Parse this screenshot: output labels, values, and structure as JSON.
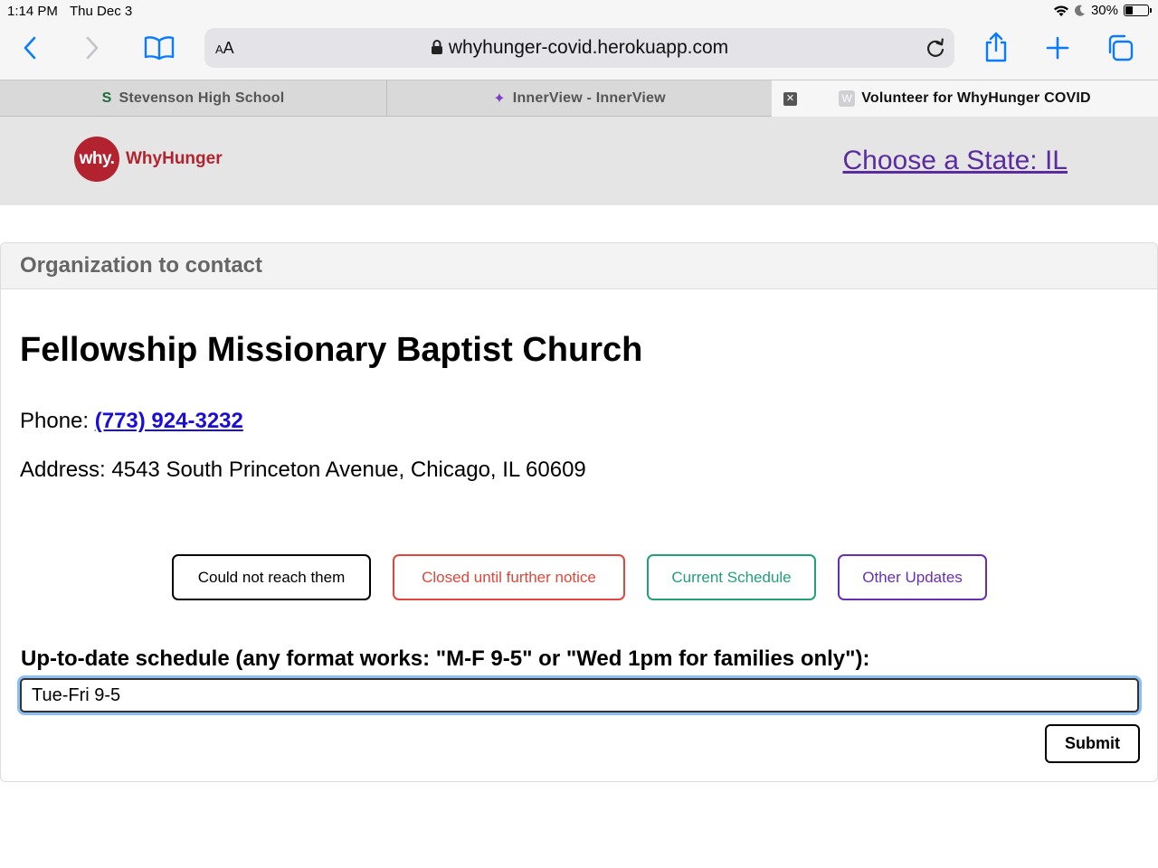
{
  "status_bar": {
    "time": "1:14 PM",
    "date": "Thu Dec 3",
    "battery": "30%"
  },
  "browser": {
    "aa_label_small": "A",
    "aa_label_big": "A",
    "url": "whyhunger-covid.herokuapp.com",
    "tabs": [
      {
        "favicon": "S",
        "label": "Stevenson High School"
      },
      {
        "favicon": "✦",
        "label": "InnerView - InnerView"
      },
      {
        "favicon": "W",
        "label": "Volunteer for WhyHunger COVID"
      }
    ]
  },
  "site": {
    "logo_mark": "why.",
    "logo_text": "WhyHunger",
    "state_link": "Choose a State: IL"
  },
  "card": {
    "header": "Organization to contact",
    "org_name": "Fellowship Missionary Baptist Church",
    "phone_label": "Phone: ",
    "phone": "(773) 924-3232",
    "address": "Address: 4543 South Princeton Avenue, Chicago, IL 60609",
    "buttons": {
      "no_reach": "Could not reach them",
      "closed": "Closed until further notice",
      "schedule": "Current Schedule",
      "other": "Other Updates"
    },
    "schedule_label": "Up-to-date schedule (any format works: \"M-F 9-5\" or \"Wed 1pm for families only\"):",
    "schedule_value": "Tue-Fri 9-5",
    "submit": "Submit"
  },
  "colors": {
    "brand": "#b3232f",
    "link": "#1a0dd6",
    "state_link": "#5a2ca0",
    "closed": "#e0463a",
    "schedule": "#22a07a",
    "other": "#6a2fb0",
    "ios_blue": "#0a7aff"
  },
  "icons": [
    "back-icon",
    "forward-icon",
    "bookmarks-icon",
    "lock-icon",
    "reload-icon",
    "share-icon",
    "new-tab-icon",
    "tabs-icon",
    "wifi-icon",
    "moon-icon",
    "battery-icon",
    "tab-close-icon"
  ]
}
